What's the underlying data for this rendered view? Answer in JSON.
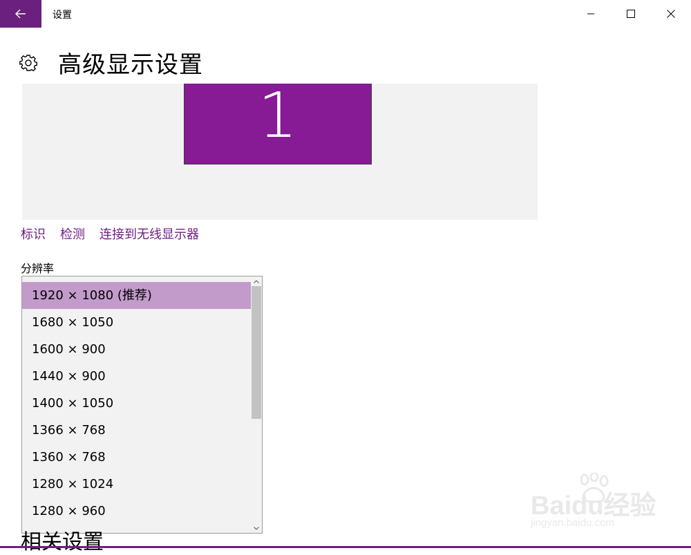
{
  "window": {
    "title": "设置"
  },
  "page": {
    "title": "高级显示设置"
  },
  "display": {
    "monitor_number": "1",
    "accent_color": "#871a95"
  },
  "links": {
    "identify": "标识",
    "detect": "检测",
    "connect_wireless": "连接到无线显示器"
  },
  "resolution": {
    "label": "分辨率",
    "options": [
      "1920 × 1080 (推荐)",
      "1680 × 1050",
      "1600 × 900",
      "1440 × 900",
      "1400 × 1050",
      "1366 × 768",
      "1360 × 768",
      "1280 × 1024",
      "1280 × 960"
    ],
    "selected_index": 0
  },
  "related": {
    "heading": "相关设置"
  },
  "watermark": {
    "logo_text": "Baidu经验",
    "url_text": "jingyan.baidu.com"
  }
}
